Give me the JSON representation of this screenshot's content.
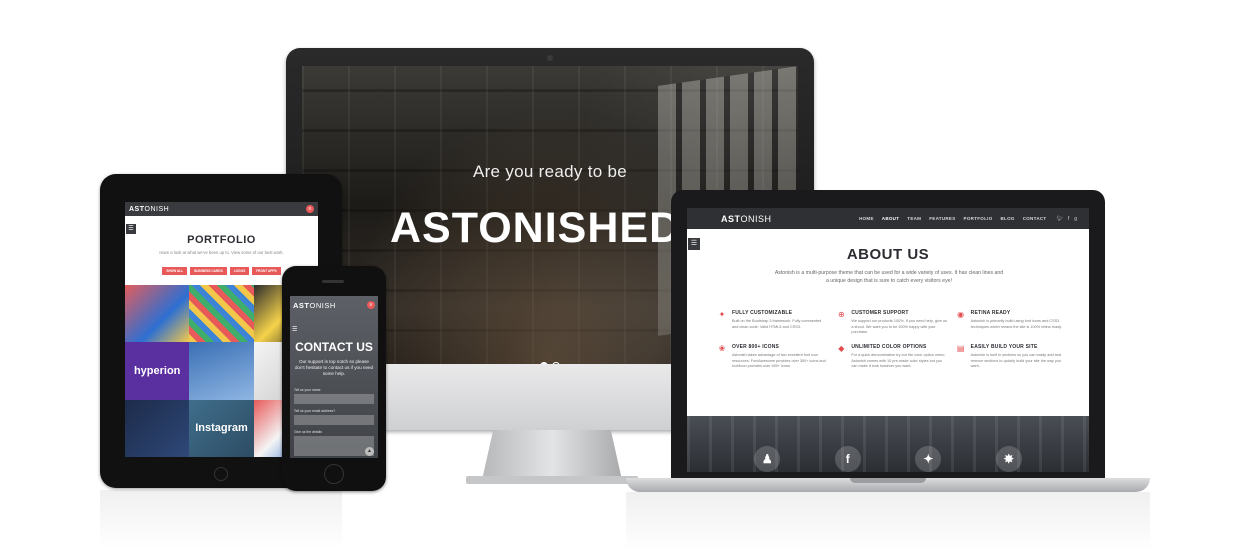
{
  "imac": {
    "hero_pre": "Are you ready to be",
    "hero_title": "ASTONISHED"
  },
  "macbook": {
    "logo_bold": "AST",
    "logo_rest": "ONISH",
    "menu": [
      "HOME",
      "ABOUT",
      "TEAM",
      "FEATURES",
      "PORTFOLIO",
      "BLOG",
      "CONTACT"
    ],
    "active_menu": "ABOUT",
    "social": [
      "twitter-icon",
      "facebook-icon",
      "google-plus-icon"
    ],
    "about_title": "ABOUT US",
    "about_desc": "Astonish is a multi-purpose theme that can be used for a wide variety of uses. It has clean lines and a unique design that is sure to catch every visitors eye!",
    "features": [
      {
        "icon": "magic-wand-icon",
        "title": "FULLY CUSTOMIZABLE",
        "text": "Built on the Bootstrap 3 framework. Fully commented and clean code. Valid HTML5 and CSS3."
      },
      {
        "icon": "lifebuoy-icon",
        "title": "CUSTOMER SUPPORT",
        "text": "We support our products 100%. If you need help, give us a shout. We want you to be 100% happy with your purchase."
      },
      {
        "icon": "eye-icon",
        "title": "RETINA READY",
        "text": "Astonish is primarily build using font icons and CSS3 techniques which means the site is 100% retina ready."
      },
      {
        "icon": "fire-icon",
        "title": "OVER 800+ ICONS",
        "text": "Astonish takes advantage of two excellent font icon resources. FontAwesome provides over 350+ icons and IcoMoon provides over 450+ icons."
      },
      {
        "icon": "drop-icon",
        "title": "UNLIMITED COLOR OPTIONS",
        "text": "For a quick demonstration try out the color option menu. Astonish comes with 10 pre-made color styles but you can make it look however you want."
      },
      {
        "icon": "layout-icon",
        "title": "EASILY BUILD YOUR SITE",
        "text": "Astonish is built in sections so you can easily add and remove sections to quickly build your site the way you want."
      }
    ],
    "band_icons": [
      "users-icon",
      "facebook-icon",
      "twitter-icon",
      "fire-icon"
    ]
  },
  "ipad": {
    "logo_bold": "AST",
    "logo_rest": "ONISH",
    "portfolio_title": "PORTFOLIO",
    "portfolio_sub": "Have a look at what we've been up to. View some of our best work.",
    "filters": [
      "SHOW ALL",
      "BUSINESS CARDS",
      "LOGOS",
      "FRONT APPS"
    ],
    "tiles": [
      "",
      "",
      "",
      "hyperion",
      "",
      "",
      "",
      "Instagram",
      ""
    ]
  },
  "iphone": {
    "logo_bold": "AST",
    "logo_rest": "ONISH",
    "contact_title": "CONTACT US",
    "contact_desc": "Our support is top notch so please don't hesitate to contact us if you need some help.",
    "fields": [
      "Tell us your name",
      "Tell us your email address?",
      "Give us the details"
    ]
  }
}
